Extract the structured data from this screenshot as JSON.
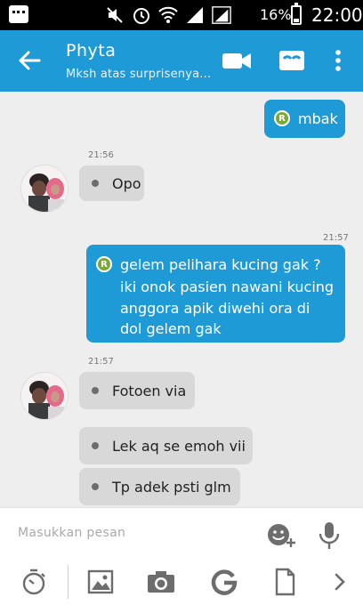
{
  "status_bar": {
    "battery_percent": "16%",
    "time": "22:00",
    "icons": [
      "bbm-icon",
      "mute-icon",
      "alarm-icon",
      "wifi-icon",
      "signal-icon",
      "signal-icon",
      "battery-icon"
    ]
  },
  "header": {
    "title": "Phyta",
    "subtitle": "Mksh atas surprisenya...",
    "accent_color": "#1e9ad6"
  },
  "messages": [
    {
      "direction": "out",
      "badge": "R",
      "text": "mbak"
    },
    {
      "direction": "in",
      "time": "21:56",
      "text": "Opo"
    },
    {
      "direction": "out",
      "time": "21:57",
      "badge": "R",
      "lines": [
        "gelem pelihara kucing gak ?",
        "iki onok pasien nawani kucing",
        "anggora apik diwehi ora di",
        "dol gelem gak"
      ]
    },
    {
      "direction": "in",
      "time": "21:57",
      "text": "Fotoen via"
    },
    {
      "direction": "in",
      "text": "Lek aq se emoh vii"
    },
    {
      "direction": "in",
      "text": "Tp adek psti glm"
    }
  ],
  "composer": {
    "placeholder": "Masukkan pesan"
  },
  "toolbar": {
    "items": [
      "timer-icon",
      "image-icon",
      "camera-icon",
      "google-icon",
      "file-icon",
      "chevron-right-icon"
    ]
  }
}
